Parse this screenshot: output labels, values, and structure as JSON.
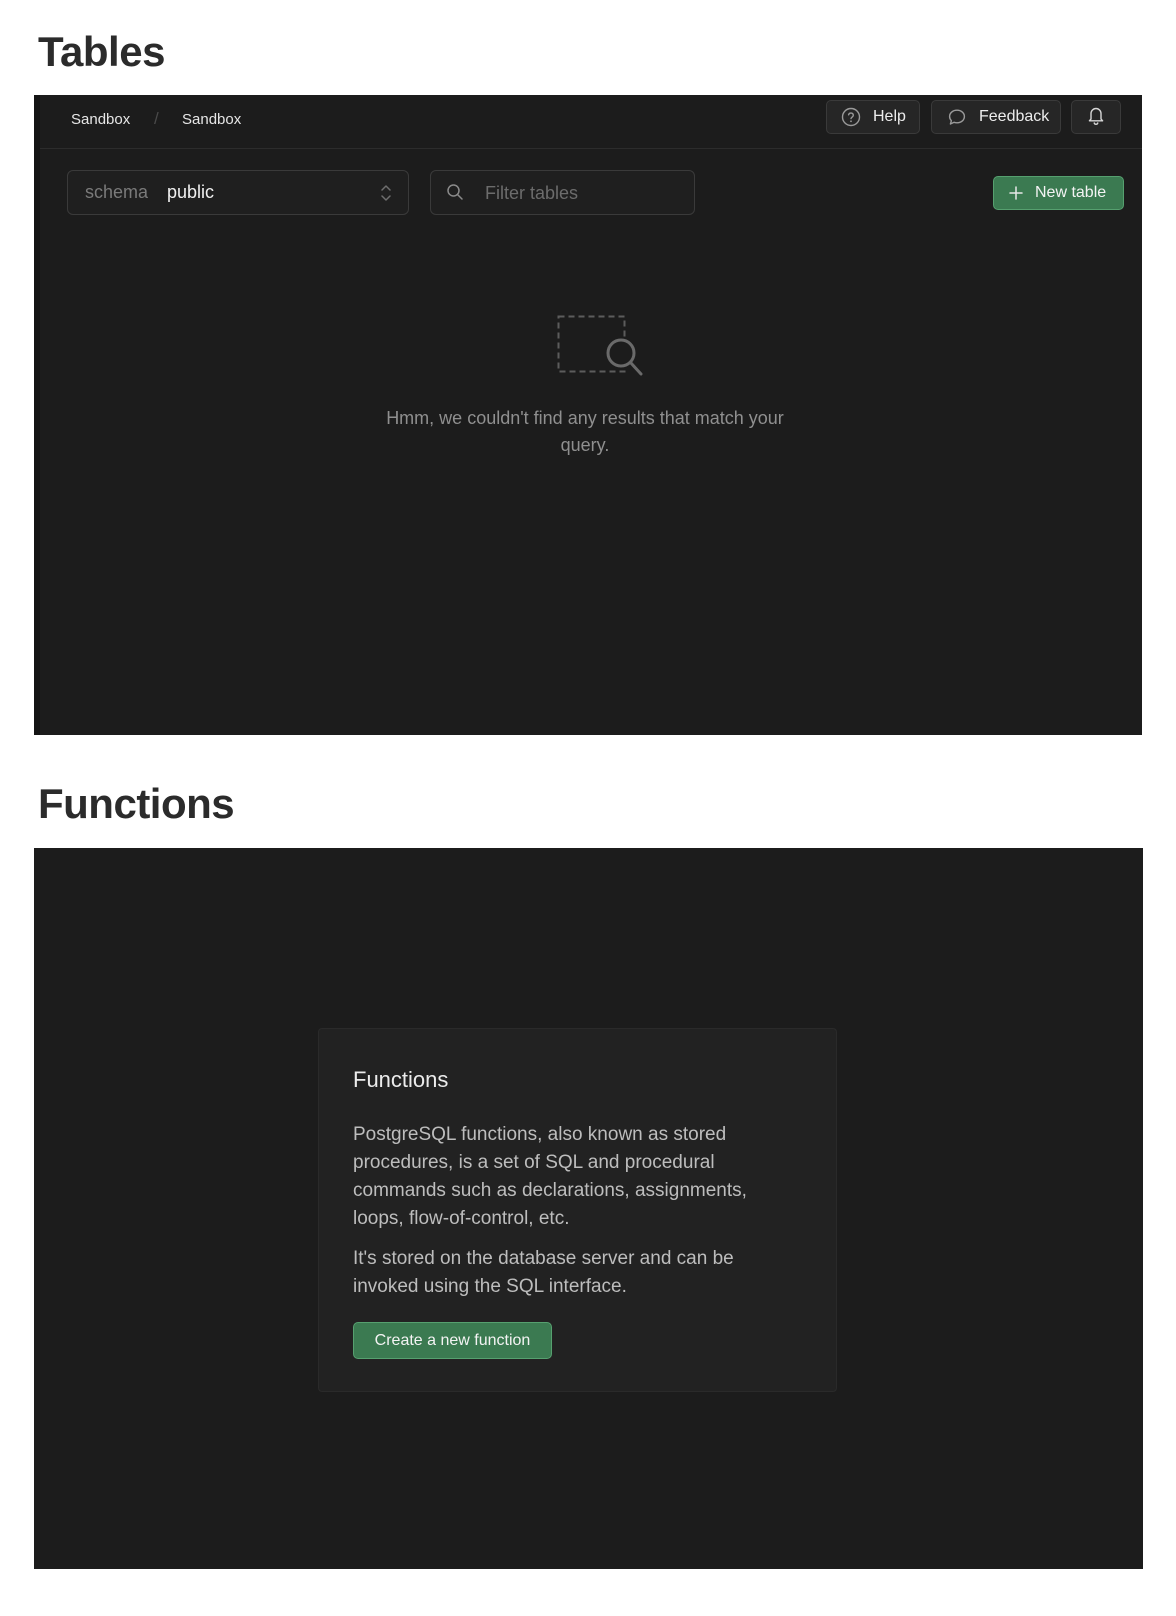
{
  "tables_section": {
    "title": "Tables",
    "breadcrumb": [
      "Sandbox",
      "Sandbox"
    ],
    "breadcrumb_separator": "/",
    "help_label": "Help",
    "feedback_label": "Feedback",
    "schema": {
      "prefix": "schema",
      "value": "public"
    },
    "filter": {
      "placeholder": "Filter tables",
      "value": ""
    },
    "new_table_label": "New table",
    "empty_message": "Hmm, we couldn't find any results that match your query.",
    "icons": [
      "help-icon",
      "feedback-icon",
      "bell-icon",
      "search-icon",
      "chevrons-up-down-icon",
      "plus-icon",
      "empty-search-icon"
    ]
  },
  "functions_section": {
    "title": "Functions",
    "card": {
      "title": "Functions",
      "paragraphs": [
        "PostgreSQL functions, also known as stored procedures, is a set of SQL and procedural commands such as declarations, assignments, loops, flow-of-control, etc.",
        "It's stored on the database server and can be invoked using the SQL interface."
      ],
      "button_label": "Create a new function"
    }
  },
  "colors": {
    "panel_bg": "#1c1c1c",
    "accent_green": "#3b7a51",
    "accent_green_border": "#56a06f",
    "heading": "#2b2b2b"
  }
}
